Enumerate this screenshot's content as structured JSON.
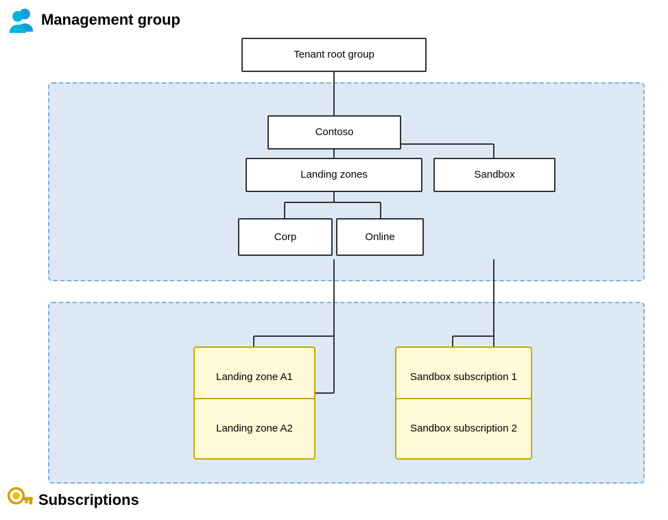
{
  "labels": {
    "management_group": "Management group",
    "subscriptions": "Subscriptions"
  },
  "nodes": {
    "tenant_root": "Tenant root group",
    "contoso": "Contoso",
    "landing_zones": "Landing zones",
    "sandbox": "Sandbox",
    "corp": "Corp",
    "online": "Online",
    "landing_zone_a1": "Landing zone A1",
    "landing_zone_a2": "Landing zone A2",
    "sandbox_sub1": "Sandbox subscription 1",
    "sandbox_sub2": "Sandbox subscription 2"
  }
}
